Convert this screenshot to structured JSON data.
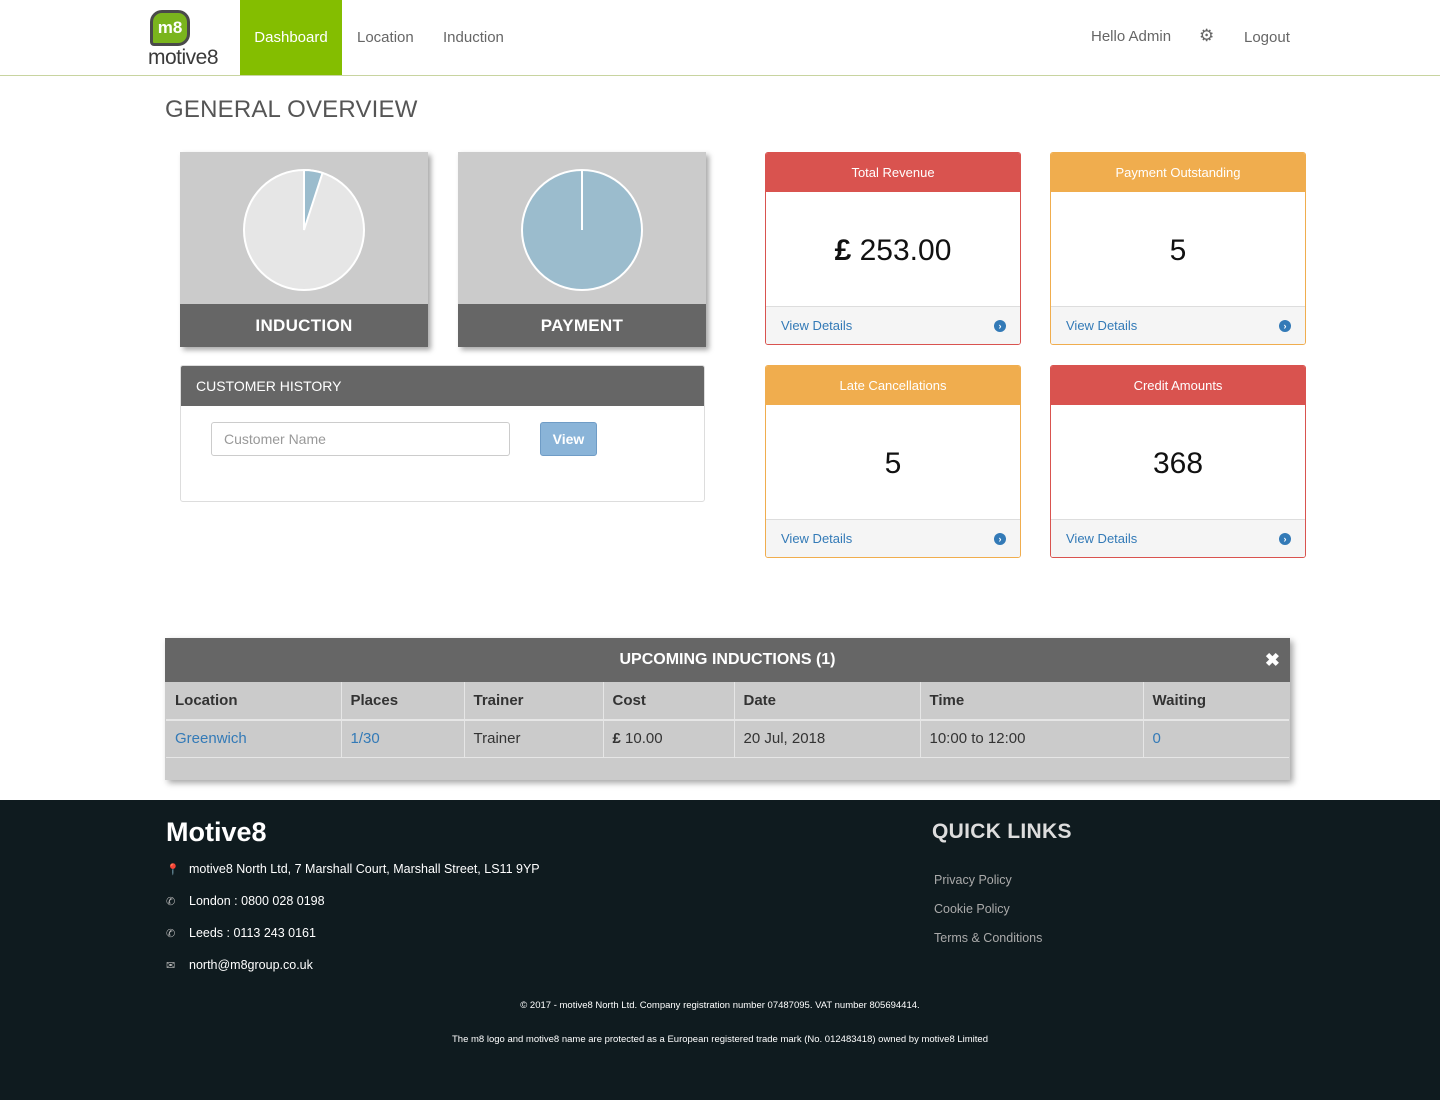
{
  "nav": {
    "logo_badge": "m8",
    "logo_text": "motive8",
    "dashboard": "Dashboard",
    "location": "Location",
    "induction": "Induction",
    "hello": "Hello Admin",
    "logout": "Logout",
    "settings_icon": "gear-icon"
  },
  "page": {
    "title": "GENERAL OVERVIEW"
  },
  "pies": {
    "induction": {
      "label": "INDUCTION",
      "slice_fraction": 0.05
    },
    "payment": {
      "label": "PAYMENT",
      "slice_fraction": 1.0
    },
    "colors": {
      "slice": "#9bbccd",
      "remainder": "#e6e6e6"
    }
  },
  "history": {
    "title": "CUSTOMER HISTORY",
    "placeholder": "Customer Name",
    "button": "View"
  },
  "stats": [
    {
      "title": "Total Revenue",
      "currency": "£",
      "value": "253.00",
      "link": "View Details",
      "color": "red"
    },
    {
      "title": "Payment Outstanding",
      "value": "5",
      "link": "View Details",
      "color": "orange"
    },
    {
      "title": "Late Cancellations",
      "value": "5",
      "link": "View Details",
      "color": "orange"
    },
    {
      "title": "Credit Amounts",
      "value": "368",
      "link": "View Details",
      "color": "red"
    }
  ],
  "colors": {
    "brand_green": "#84be00",
    "red": "#d9534f",
    "orange": "#f0ad4e",
    "link": "#337ab7",
    "footer_bg": "#0f1b1f"
  },
  "upcoming": {
    "title": "UPCOMING INDUCTIONS (1)",
    "close_icon": "close-icon",
    "columns": [
      "Location",
      "Places",
      "Trainer",
      "Cost",
      "Date",
      "Time",
      "Waiting"
    ],
    "rows": [
      {
        "location": "Greenwich",
        "places": "1/30",
        "trainer": "Trainer",
        "cost_currency": "£",
        "cost": "10.00",
        "date": "20 Jul, 2018",
        "time": "10:00 to 12:00",
        "waiting": "0"
      }
    ]
  },
  "footer": {
    "brand": "Motive8",
    "address": "motive8 North Ltd, 7 Marshall Court, Marshall Street, LS11 9YP",
    "london": "London : 0800 028 0198",
    "leeds": "Leeds : 0113 243 0161",
    "email": "north@m8group.co.uk",
    "quick_links_title": "QUICK LINKS",
    "links": [
      "Privacy Policy",
      "Cookie Policy",
      "Terms & Conditions"
    ],
    "copyright": "© 2017 - motive8 North Ltd. Company registration number 07487095. VAT number 805694414.",
    "trademark": "The m8 logo and motive8 name are protected as a European registered trade mark (No. 012483418) owned by motive8 Limited"
  }
}
